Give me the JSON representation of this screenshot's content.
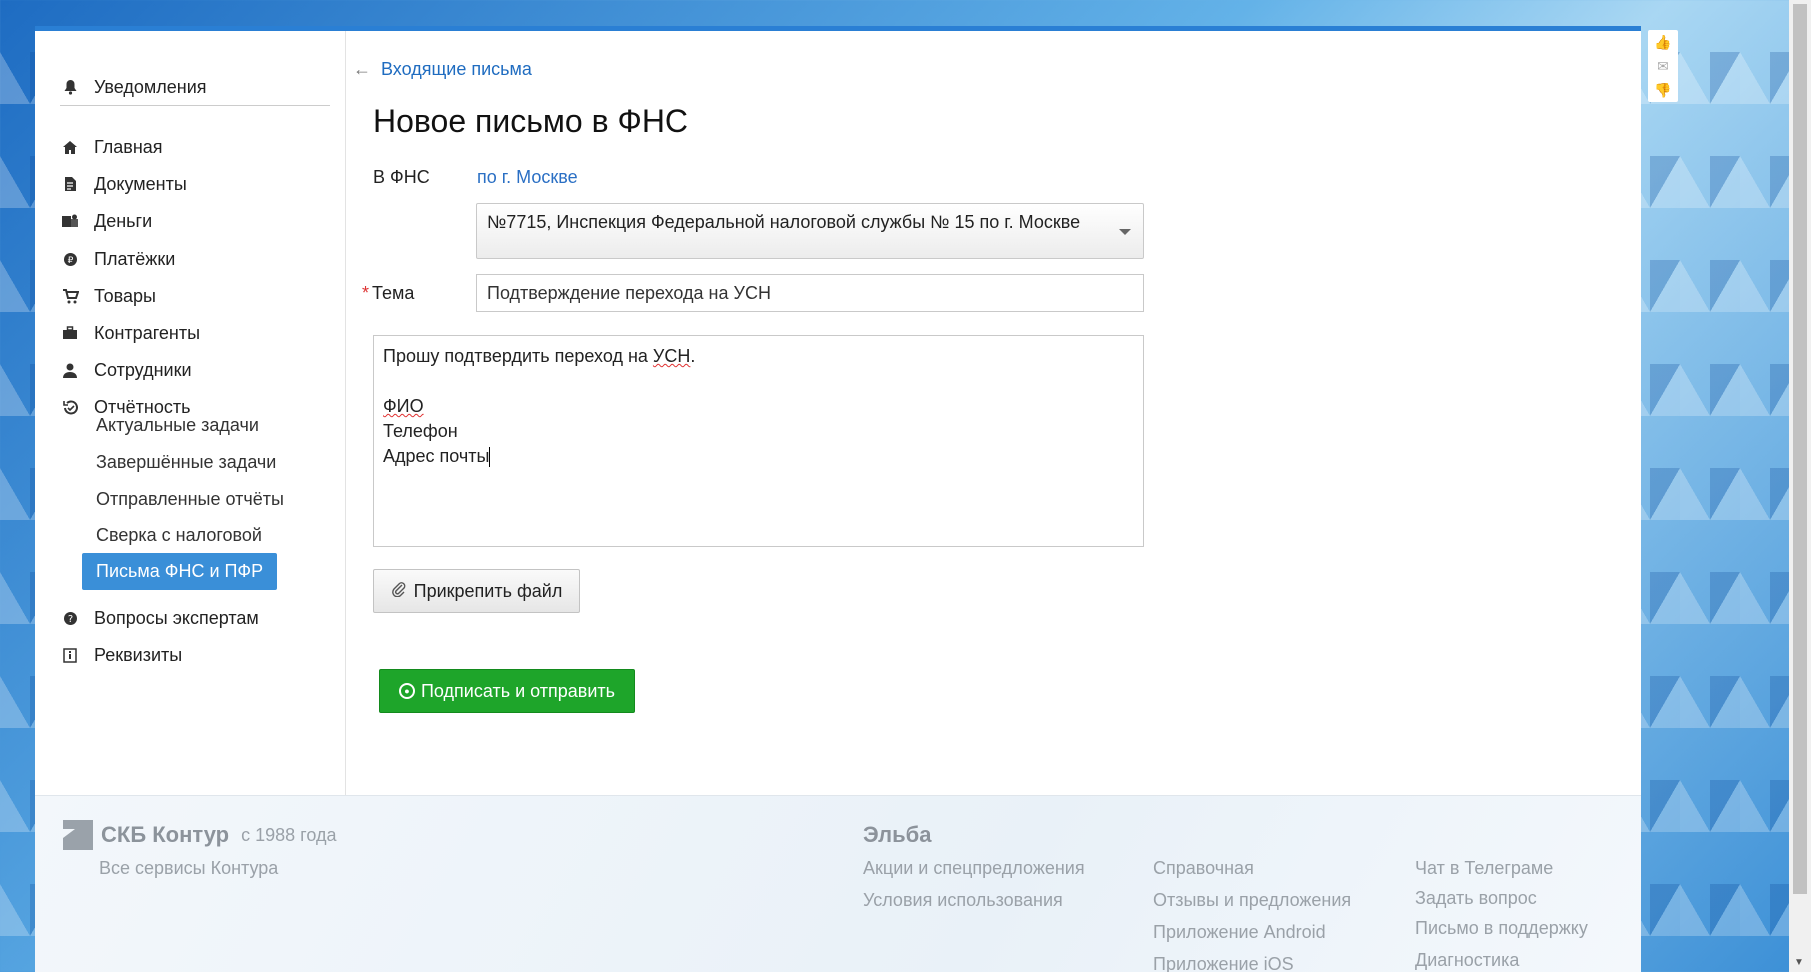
{
  "sidebar": {
    "notifications": {
      "label": "Уведомления",
      "icon": "bell-icon"
    },
    "items": [
      {
        "label": "Главная",
        "icon": "home-icon"
      },
      {
        "label": "Документы",
        "icon": "document-icon"
      },
      {
        "label": "Деньги",
        "icon": "money-icon"
      },
      {
        "label": "Платёжки",
        "icon": "payment-icon"
      },
      {
        "label": "Товары",
        "icon": "cart-icon"
      },
      {
        "label": "Контрагенты",
        "icon": "briefcase-icon"
      },
      {
        "label": "Сотрудники",
        "icon": "person-icon"
      },
      {
        "label": "Отчётность",
        "icon": "report-icon"
      }
    ],
    "subitems": [
      {
        "label": "Актуальные задачи"
      },
      {
        "label": "Завершённые задачи"
      },
      {
        "label": "Отправленные отчёты"
      },
      {
        "label": "Сверка с налоговой"
      },
      {
        "label": "Письма ФНС и ПФР",
        "active": true
      }
    ],
    "bottom_items": [
      {
        "label": "Вопросы экспертам",
        "icon": "question-icon"
      },
      {
        "label": "Реквизиты",
        "icon": "info-icon"
      }
    ],
    "active_color": "#3a8fd8"
  },
  "main": {
    "back_link": "Входящие письма",
    "title": "Новое письмо в ФНС",
    "to_label": "В ФНС",
    "to_value": "по г. Москве",
    "inspection_select": "№7715, Инспекция Федеральной налоговой службы № 15 по г. Москве",
    "subject_label": "Тема",
    "subject_value": "Подтверждение перехода на УСН",
    "body": {
      "line1_pre": "Прошу подтвердить переход на ",
      "line1_spell": "УСН",
      "line1_post": ".",
      "line2": "ФИО",
      "line3": "Телефон",
      "line4": "Адрес почты"
    },
    "attach_button": "Прикрепить файл",
    "send_button": "Подписать и отправить",
    "send_color": "#1ea52a"
  },
  "footer": {
    "brand": "СКБ Контур",
    "since": "с 1988 года",
    "all_services": "Все сервисы Контура",
    "product": "Эльба",
    "col1": [
      "Акции и спецпредложения",
      "Условия использования"
    ],
    "col2": [
      "Справочная",
      "Отзывы и предложения",
      "Приложение Android",
      "Приложение iOS"
    ],
    "col3": [
      "Чат в Телеграме",
      "Задать вопрос",
      "Письмо в поддержку",
      "Диагностика"
    ]
  }
}
